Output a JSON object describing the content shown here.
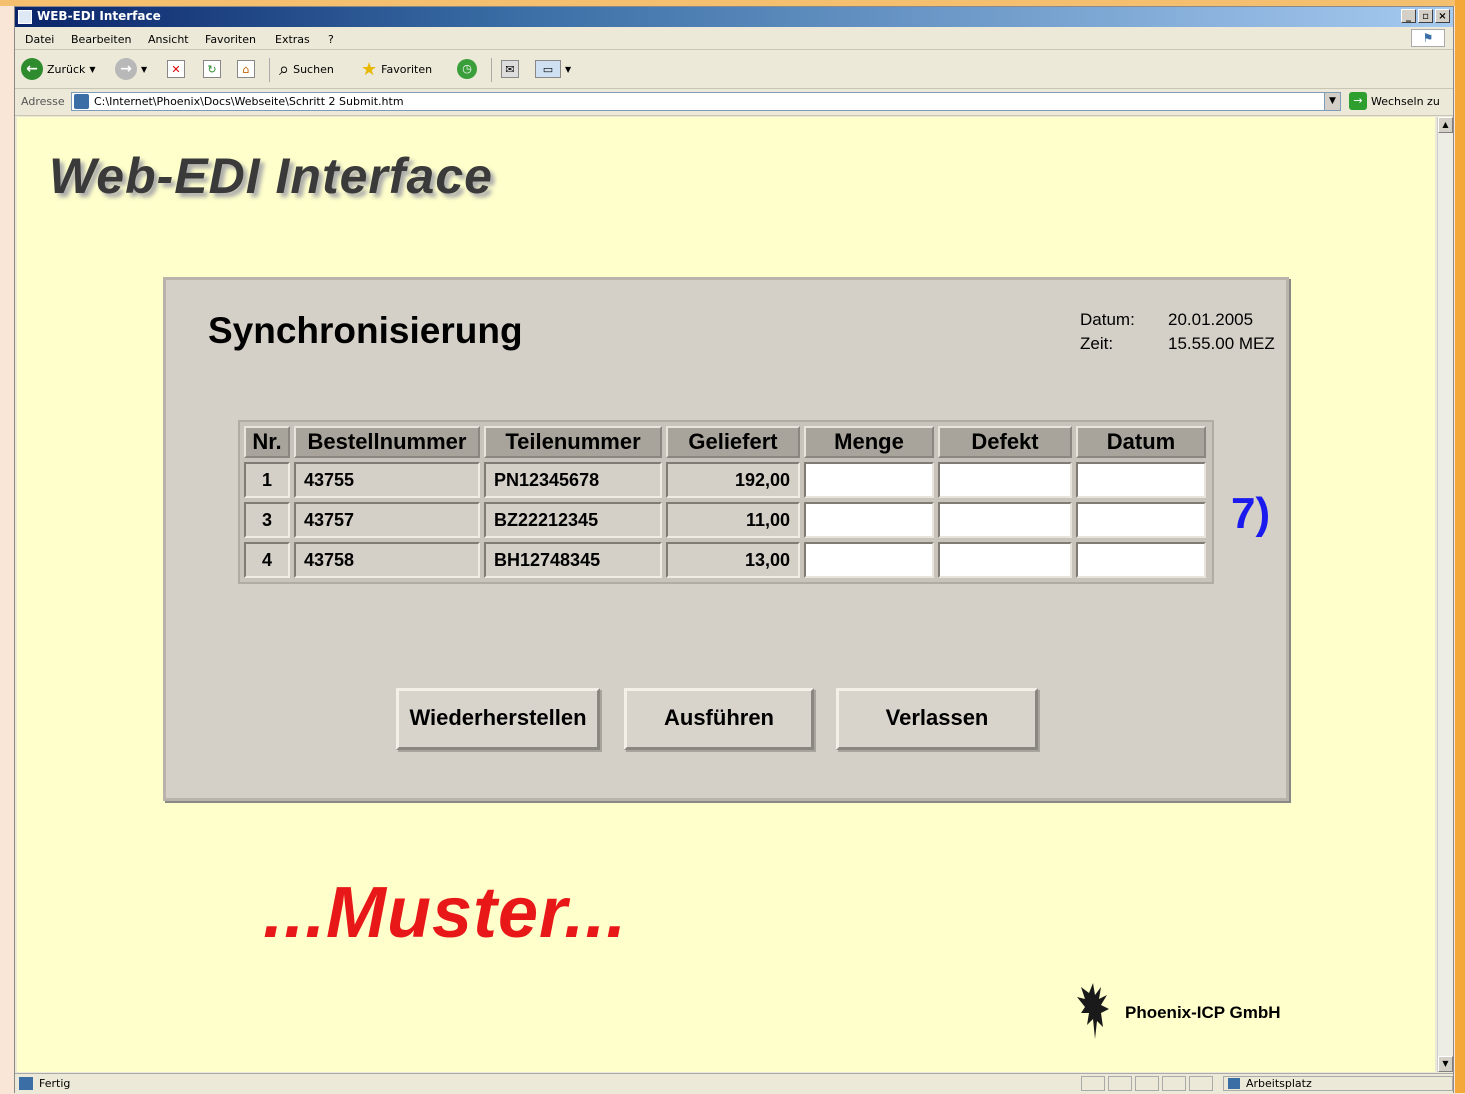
{
  "window": {
    "title": "WEB-EDI Interface",
    "controls": [
      "_",
      "▫",
      "×"
    ]
  },
  "menu": [
    "Datei",
    "Bearbeiten",
    "Ansicht",
    "Favoriten",
    "Extras",
    "?"
  ],
  "toolbar": {
    "back": "Zurück",
    "search": "Suchen",
    "favorites": "Favoriten"
  },
  "address": {
    "label": "Adresse",
    "url": "C:\\Internet\\Phoenix\\Docs\\Webseite\\Schritt 2 Submit.htm",
    "go": "Wechseln zu"
  },
  "status": {
    "left": "Fertig",
    "zone": "Arbeitsplatz"
  },
  "page": {
    "heading": "Web-EDI Interface",
    "panel_title": "Synchronisierung",
    "date_label": "Datum:",
    "date_value": "20.01.2005",
    "time_label": "Zeit:",
    "time_value": "15.55.00 MEZ",
    "step_marker": "7)",
    "watermark": "...Muster...",
    "company": "Phoenix-ICP GmbH"
  },
  "table": {
    "headers": [
      "Nr.",
      "Bestellnummer",
      "Teilenummer",
      "Geliefert",
      "Menge",
      "Defekt",
      "Datum"
    ],
    "rows": [
      {
        "nr": "1",
        "bestellnummer": "43755",
        "teilenummer": "PN12345678",
        "geliefert": "192,00",
        "menge": "",
        "defekt": "",
        "datum": ""
      },
      {
        "nr": "3",
        "bestellnummer": "43757",
        "teilenummer": "BZ22212345",
        "geliefert": "11,00",
        "menge": "",
        "defekt": "",
        "datum": ""
      },
      {
        "nr": "4",
        "bestellnummer": "43758",
        "teilenummer": "BH12748345",
        "geliefert": "13,00",
        "menge": "",
        "defekt": "",
        "datum": ""
      }
    ]
  },
  "buttons": {
    "restore": "Wiederherstellen",
    "execute": "Ausführen",
    "leave": "Verlassen"
  }
}
